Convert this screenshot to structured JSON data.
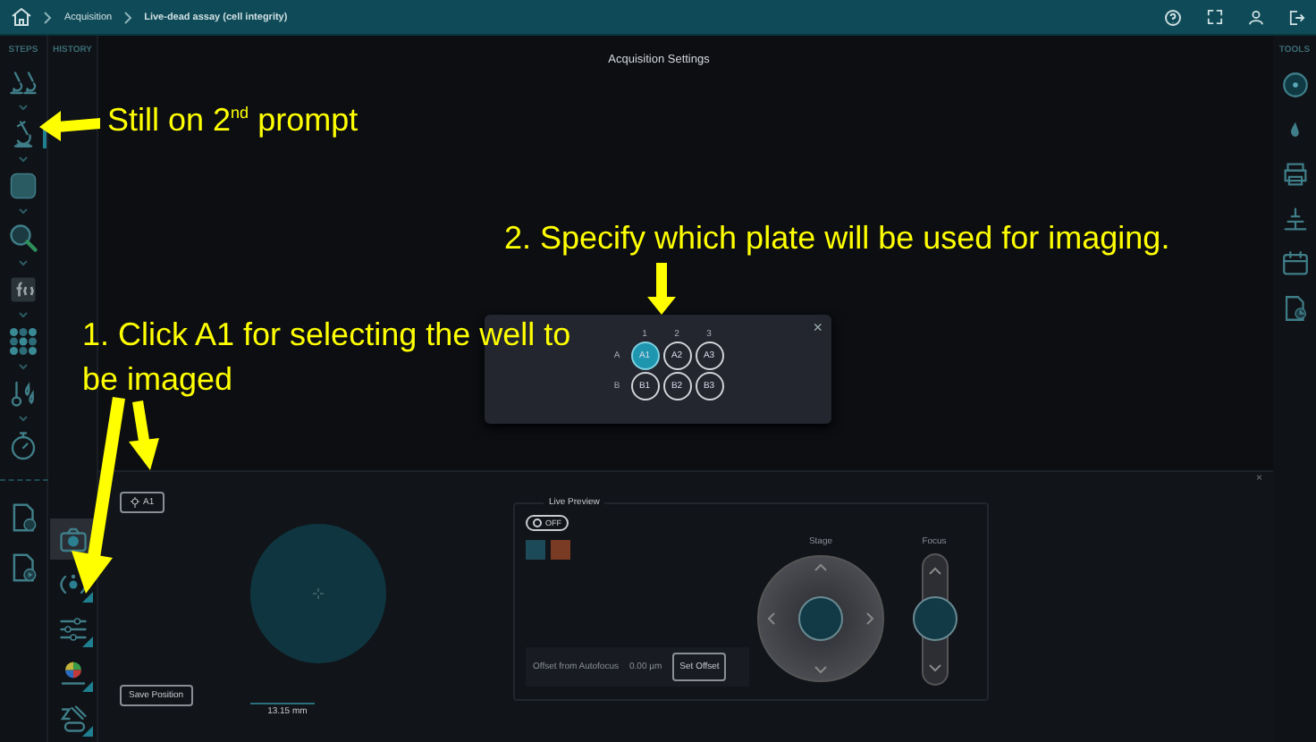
{
  "breadcrumb": [
    "Acquisition",
    "Live-dead assay (cell integrity)"
  ],
  "steps": {
    "title": "STEPS",
    "items": [
      {
        "kind": "microscope-pair",
        "selected": false
      },
      {
        "kind": "microscope",
        "selected": true
      },
      {
        "kind": "chip",
        "selected": false
      },
      {
        "kind": "magnifier",
        "selected": false
      },
      {
        "kind": "function",
        "selected": false
      },
      {
        "kind": "well-grid",
        "selected": false
      },
      {
        "kind": "thermometer",
        "selected": false
      },
      {
        "kind": "timer",
        "selected": false
      }
    ],
    "extras": [
      {
        "kind": "document-gear"
      },
      {
        "kind": "document-play"
      }
    ]
  },
  "history": {
    "title": "HISTORY",
    "tools": [
      {
        "kind": "camera",
        "selected": true
      },
      {
        "kind": "autofocus",
        "selected": false
      },
      {
        "kind": "sliders",
        "selected": false
      },
      {
        "kind": "color-wheel",
        "selected": false
      },
      {
        "kind": "z-off",
        "selected": false
      }
    ]
  },
  "tools": {
    "title": "TOOLS",
    "items": [
      {
        "kind": "disc"
      },
      {
        "kind": "drop"
      },
      {
        "kind": "printer"
      },
      {
        "kind": "stage"
      },
      {
        "kind": "calendar"
      },
      {
        "kind": "document-clock"
      }
    ]
  },
  "main": {
    "title": "Acquisition Settings"
  },
  "plate_dialog": {
    "close": "×",
    "columns": [
      "1",
      "2",
      "3"
    ],
    "rows": [
      {
        "label": "A",
        "wells": [
          {
            "label": "A1",
            "selected": true
          },
          {
            "label": "A2",
            "selected": false
          },
          {
            "label": "A3",
            "selected": false
          }
        ]
      },
      {
        "label": "B",
        "wells": [
          {
            "label": "B1",
            "selected": false
          },
          {
            "label": "B2",
            "selected": false
          },
          {
            "label": "B3",
            "selected": false
          }
        ]
      }
    ]
  },
  "bottom_panel": {
    "close": "×",
    "well_button": "A1",
    "scale": "13.15  mm",
    "save_button": "Save Position",
    "live_preview": {
      "title": "Live Preview",
      "toggle": {
        "label": "OFF",
        "on": false
      },
      "channels": [
        {
          "color": "#1d4a58"
        },
        {
          "color": "#7a3b24"
        }
      ],
      "offset_label": "Offset from Autofocus",
      "offset_value": "0.00 µm",
      "offset_button": "Set Offset",
      "stage_label": "Stage",
      "focus_label": "Focus"
    }
  },
  "annotations": [
    {
      "text": "Still on 2$^{nd}$ prompt"
    },
    {
      "text": "2. Specify which plate will be used for imaging."
    },
    {
      "text": "1. Click A1 for selecting the well to be imaged"
    }
  ]
}
